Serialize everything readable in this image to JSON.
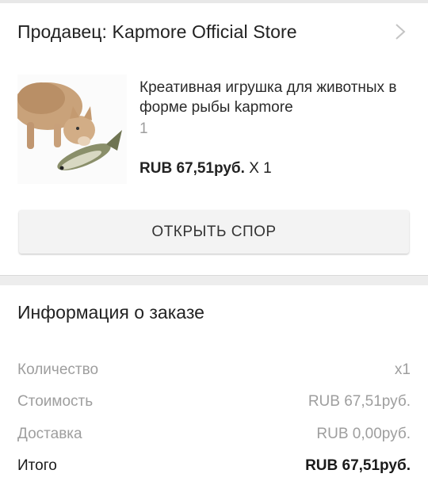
{
  "seller": {
    "label": "Продавец: Kapmore Official Store",
    "chevron_icon": "chevron-right-icon"
  },
  "product": {
    "image_icon": "cat-with-fish-toy-image",
    "title": "Креативная игрушка для животных в форме рыбы kapmore",
    "variant": "1",
    "price": "RUB 67,51руб.",
    "quantity": " X 1"
  },
  "dispute_button": "ОТКРЫТЬ СПОР",
  "order_info": {
    "title": "Информация о заказе",
    "rows": [
      {
        "label": "Количество",
        "value": "x1"
      },
      {
        "label": "Стоимость",
        "value": "RUB 67,51руб."
      },
      {
        "label": "Доставка",
        "value": "RUB 0,00руб."
      },
      {
        "label": "Итого",
        "value": "RUB 67,51руб."
      }
    ]
  },
  "colors": {
    "text": "#222222",
    "muted": "#9e9e9e",
    "button_bg": "#f3f3f3",
    "divider": "#ededed"
  }
}
